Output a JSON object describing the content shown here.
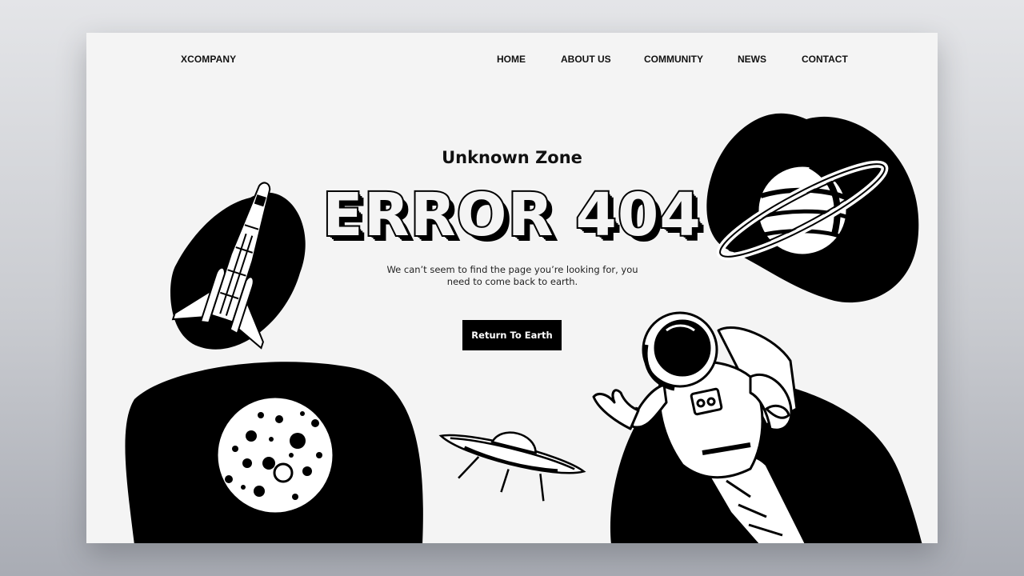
{
  "brand": {
    "logo_text": "XCOMPANY"
  },
  "nav": {
    "items": [
      {
        "label": "HOME"
      },
      {
        "label": "ABOUT US"
      },
      {
        "label": "COMMUNITY"
      },
      {
        "label": "NEWS"
      },
      {
        "label": "CONTACT"
      }
    ]
  },
  "hero": {
    "subtitle": "Unknown Zone",
    "error_title": "ERROR 404",
    "description": "We can’t seem to find the page you’re looking for, you need to come back to earth.",
    "cta_label": "Return To Earth"
  },
  "illustrations": [
    {
      "icon": "space-shuttle-icon"
    },
    {
      "icon": "saturn-planet-icon"
    },
    {
      "icon": "moon-icon"
    },
    {
      "icon": "ufo-icon"
    },
    {
      "icon": "astronaut-icon"
    }
  ],
  "colors": {
    "background": "#f4f4f4",
    "ink": "#000000",
    "button_text": "#ffffff"
  }
}
